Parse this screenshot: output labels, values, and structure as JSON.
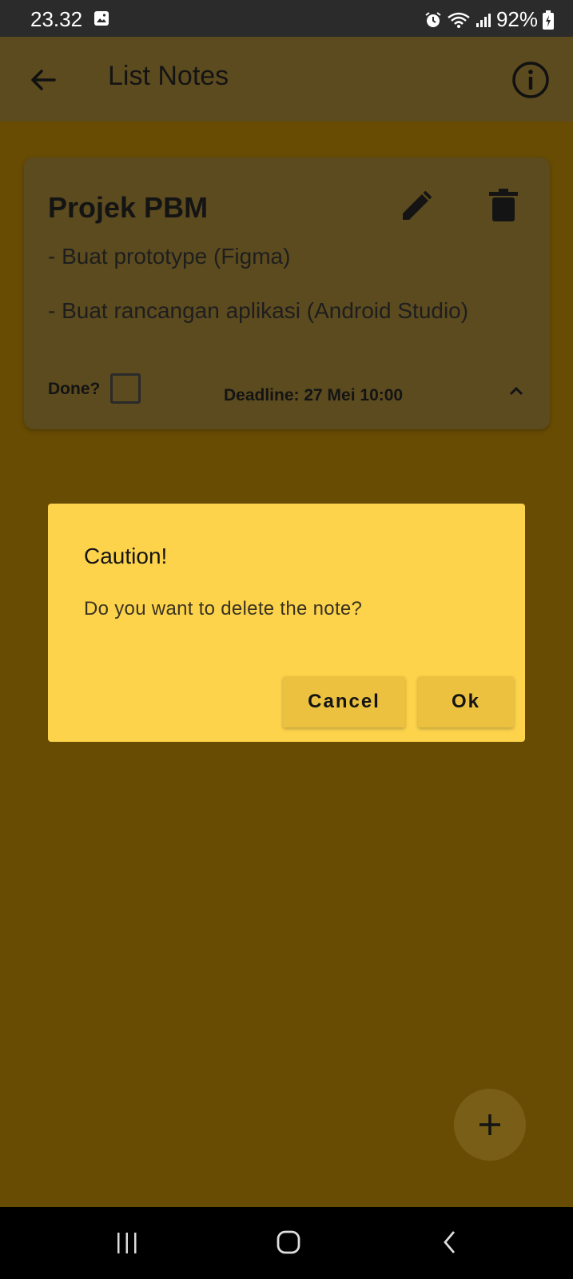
{
  "status_bar": {
    "time": "23.32",
    "battery": "92%"
  },
  "app_bar": {
    "title": "List Notes"
  },
  "note": {
    "title": "Projek PBM",
    "lines": [
      "- Buat prototype (Figma)",
      "- Buat rancangan aplikasi (Android Studio)"
    ],
    "done_label": "Done?",
    "done_checked": false,
    "deadline": "Deadline: 27 Mei 10:00"
  },
  "dialog": {
    "title": "Caution!",
    "message": "Do you want to delete the note?",
    "cancel_label": "Cancel",
    "ok_label": "Ok"
  },
  "icons": {
    "back": "arrow-left-icon",
    "info": "info-circle-icon",
    "edit": "pencil-icon",
    "delete": "trash-icon",
    "collapse": "chevron-up-icon",
    "add": "plus-icon"
  },
  "colors": {
    "dialog_bg": "#fdd34c",
    "button_bg": "#ebc13f",
    "scrim_bg": "#684c04"
  }
}
